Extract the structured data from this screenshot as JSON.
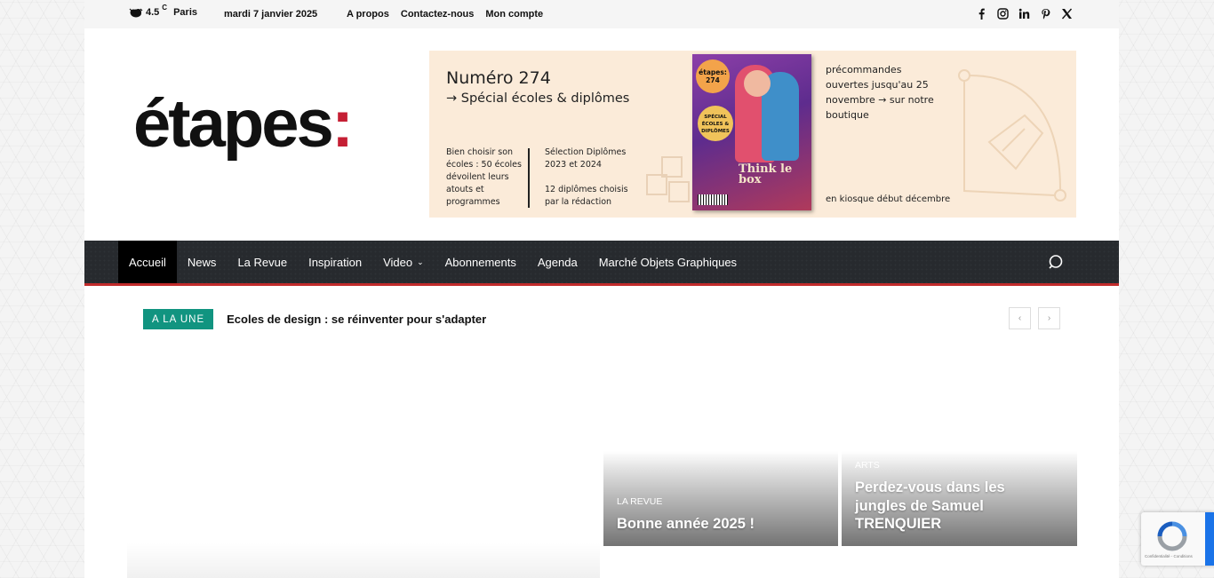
{
  "topbar": {
    "weather": {
      "icon": "cloud-rain-icon",
      "temp": "4.5",
      "unit": "C",
      "city": "Paris"
    },
    "date": "mardi 7 janvier 2025",
    "links": [
      "A propos",
      "Contactez-nous",
      "Mon compte"
    ],
    "social": [
      "facebook-icon",
      "instagram-icon",
      "linkedin-icon",
      "pinterest-icon",
      "x-icon"
    ]
  },
  "logo": {
    "text": "étapes",
    "colon": ":",
    "colon_color": "#c51f34"
  },
  "banner": {
    "title1": "Numéro 274",
    "title2": "→ Spécial écoles & diplômes",
    "col1": "Bien choisir son écoles : 50 écoles dévoilent leurs atouts et programmes",
    "col2a": "Sélection Diplômes 2023 et 2024",
    "col2b": "12 diplômes choisis par la rédaction",
    "col3": "précommandes ouvertes jusqu'au 25 novembre → sur notre boutique",
    "col4": "en kiosque début décembre",
    "cover": {
      "brand": "étapes:",
      "issue": "274",
      "badge": "SPÉCIAL ÉCOLES & DIPLÔMES",
      "art": "Think le box"
    }
  },
  "nav": {
    "items": [
      "Accueil",
      "News",
      "La Revue",
      "Inspiration",
      "Video",
      "Abonnements",
      "Agenda",
      "Marché Objets Graphiques"
    ],
    "active": "Accueil",
    "accent": "#c12b2b"
  },
  "ticker": {
    "label": "A LA UNE",
    "headline": "Ecoles de design : se réinventer pour s'adapter",
    "label_color": "#119480"
  },
  "posts": [
    {
      "category": "LA REVUE",
      "title": "Bonne année 2025 !"
    },
    {
      "category": "ARTS",
      "title": "Perdez-vous dans les jungles de Samuel TRENQUIER"
    }
  ],
  "recaptcha": {
    "text": "Confidentialité - Conditions"
  }
}
